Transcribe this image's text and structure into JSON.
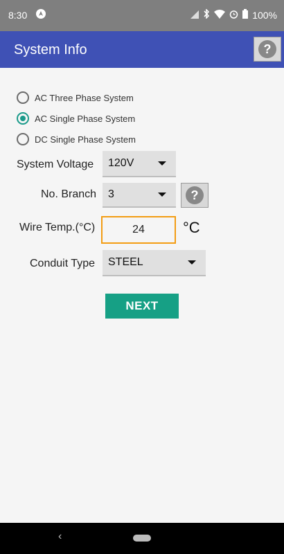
{
  "status_bar": {
    "time": "8:30",
    "battery": "100%",
    "icons": [
      "navigation-icon",
      "signal-icon",
      "bluetooth-icon",
      "wifi-icon",
      "alarm-icon",
      "battery-icon"
    ]
  },
  "app_bar": {
    "title": "System Info",
    "help_icon": "help-icon",
    "help_label": "?",
    "color": "#3f51b5"
  },
  "system_type": {
    "options": [
      {
        "label": "AC Three Phase System",
        "selected": false
      },
      {
        "label": "AC Single Phase System",
        "selected": true
      },
      {
        "label": "DC Single Phase System",
        "selected": false
      }
    ]
  },
  "form": {
    "voltage": {
      "label": "System Voltage",
      "value": "120V"
    },
    "branch": {
      "label": "No. Branch",
      "value": "3",
      "help_label": "?"
    },
    "wire_temp": {
      "label": "Wire Temp.(°C)",
      "value": "24",
      "unit": "°C"
    },
    "conduit": {
      "label": "Conduit Type",
      "value": "STEEL"
    }
  },
  "next_label": "NEXT",
  "colors": {
    "accent": "#16a085",
    "focus": "#f39c12"
  }
}
